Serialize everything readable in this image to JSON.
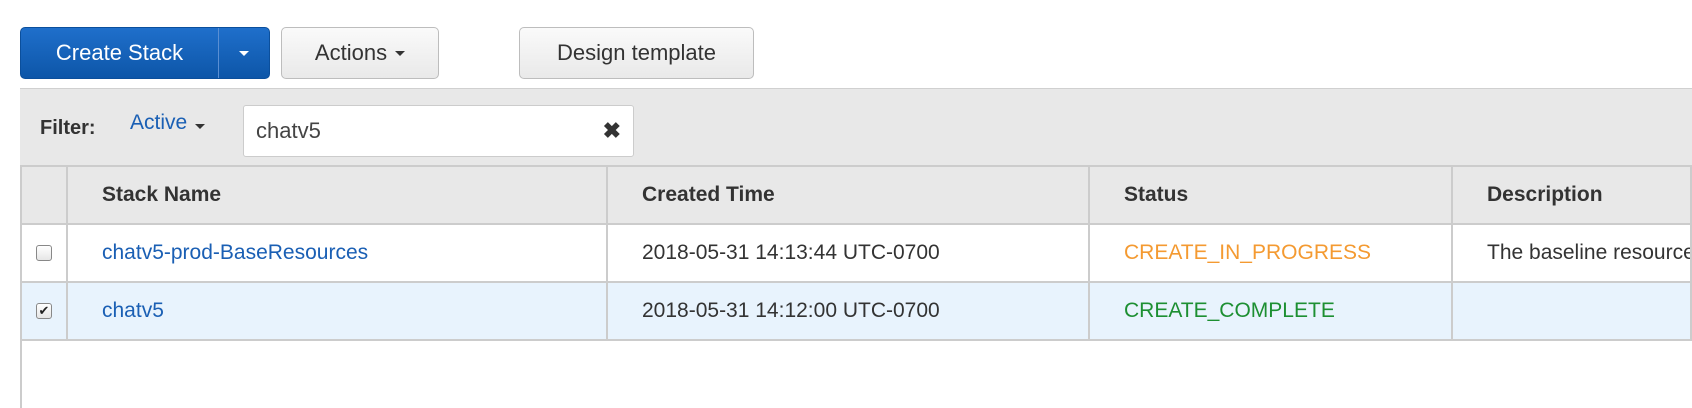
{
  "toolbar": {
    "create_stack": "Create Stack",
    "actions": "Actions",
    "design_template": "Design template"
  },
  "filter": {
    "label": "Filter:",
    "active": "Active",
    "value": "chatv5",
    "clear_icon": "close-icon"
  },
  "table": {
    "columns": [
      "Stack Name",
      "Created Time",
      "Status",
      "Description"
    ],
    "rows": [
      {
        "name": "chatv5-prod-BaseResources",
        "created": "2018-05-31 14:13:44 UTC-0700",
        "status": "CREATE_IN_PROGRESS",
        "status_color": "#f49a31",
        "description": "The baseline resources",
        "checked": false
      },
      {
        "name": "chatv5",
        "created": "2018-05-31 14:12:00 UTC-0700",
        "status": "CREATE_COMPLETE",
        "status_color": "#1d8f32",
        "description": "",
        "checked": true
      }
    ]
  }
}
